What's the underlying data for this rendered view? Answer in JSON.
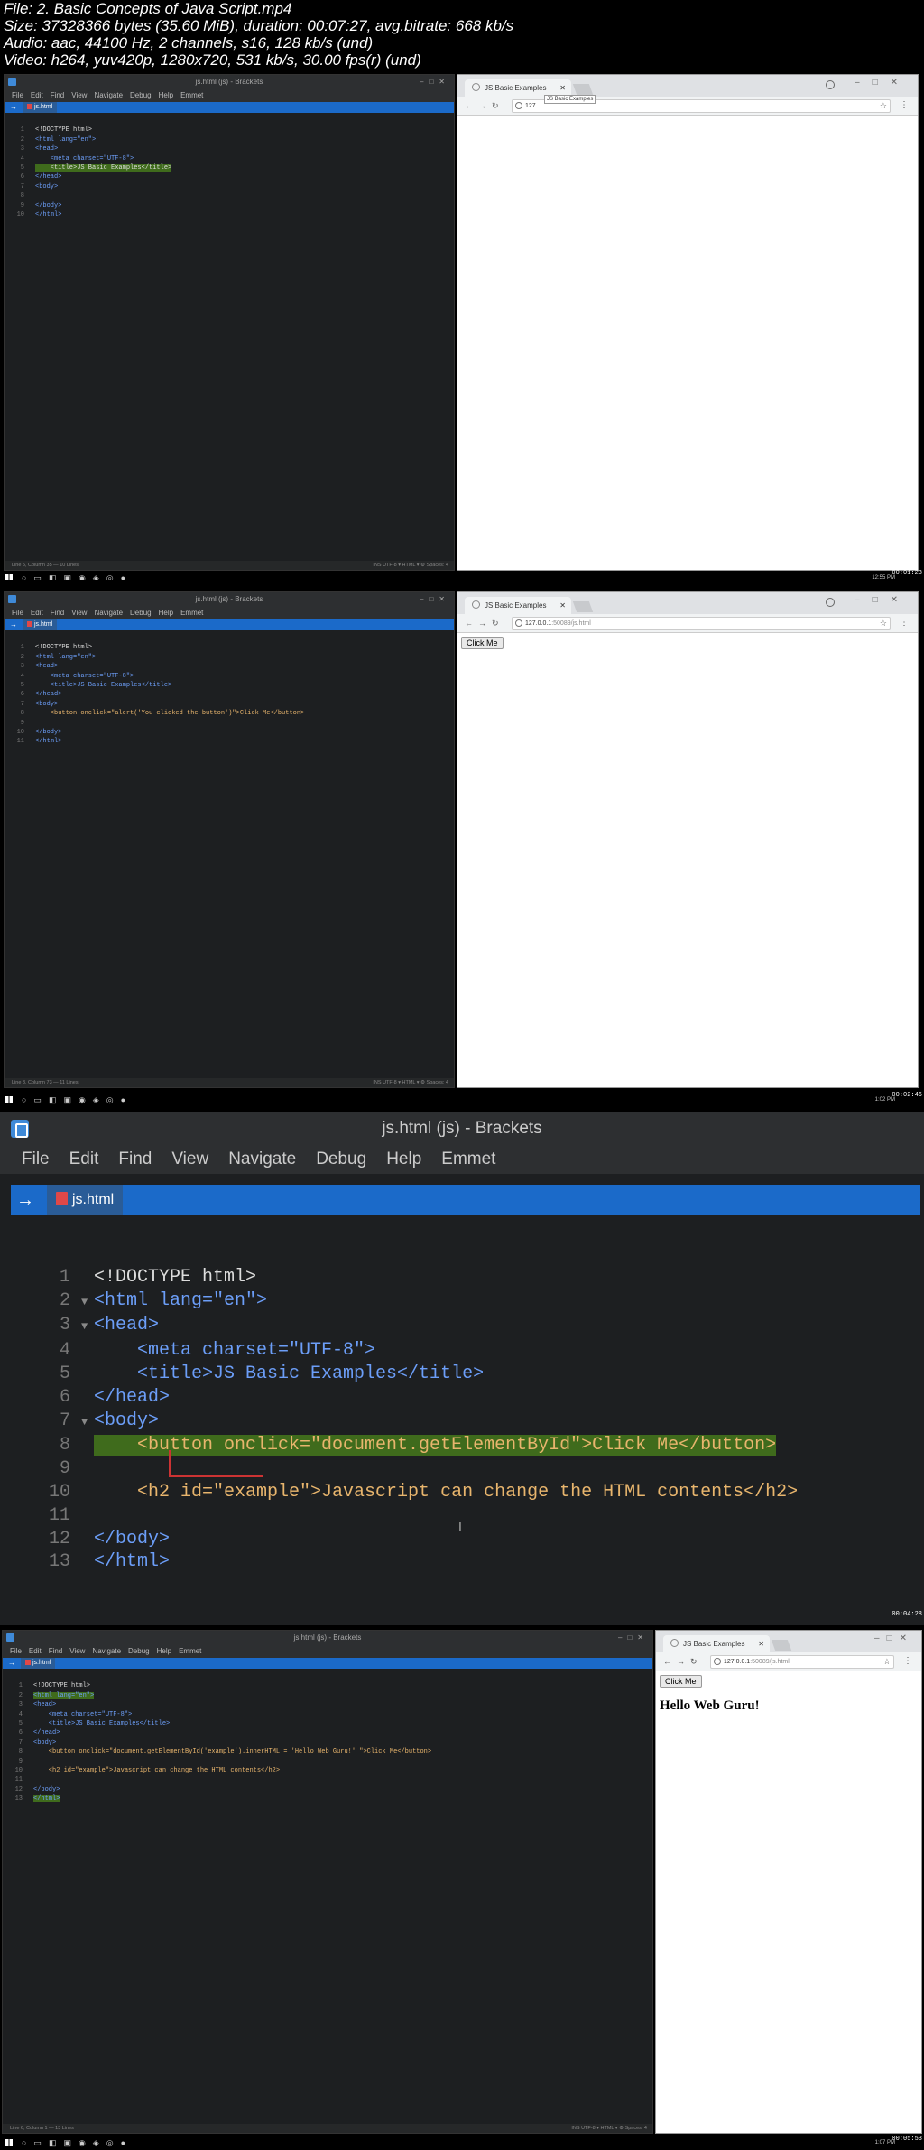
{
  "file_info": [
    "File: 2. Basic Concepts of Java Script.mp4",
    "Size: 37328366 bytes (35.60 MiB), duration: 00:07:27, avg.bitrate: 668 kb/s",
    "Audio: aac, 44100 Hz, 2 channels, s16, 128 kb/s (und)",
    "Video: h264, yuv420p, 1280x720, 531 kb/s, 30.00 fps(r) (und)"
  ],
  "editor": {
    "window_title": "js.html (js) - Brackets",
    "menu": [
      "File",
      "Edit",
      "Find",
      "View",
      "Navigate",
      "Debug",
      "Help",
      "Emmet"
    ],
    "tab_label": "js.html"
  },
  "browser": {
    "tab_title": "JS Basic Examples",
    "url_host": "127.0.0.1",
    "url_rest": ":50089/js.html",
    "tooltip": "JS Basic Examples"
  },
  "frame1": {
    "code": [
      "<!DOCTYPE html>",
      "<html lang=\"en\">",
      "<head>",
      "    <meta charset=\"UTF-8\">",
      "    <title>JS Basic Examples</title>",
      "</head>",
      "<body>",
      "",
      "</body>",
      "</html>"
    ],
    "status_left": "Line 5, Column 35 — 10 Lines",
    "status_right": "INS    UTF-8 ▾    HTML ▾    ⚙    Spaces: 4",
    "url_partial": "127.",
    "clock": "12:55 PM",
    "timestamp": "00:01:23"
  },
  "frame2": {
    "code": [
      "<!DOCTYPE html>",
      "<html lang=\"en\">",
      "<head>",
      "    <meta charset=\"UTF-8\">",
      "    <title>JS Basic Examples</title>",
      "</head>",
      "<body>",
      "    <button onclick=\"alert('You clicked the button')\">Click Me</button>",
      "",
      "</body>",
      "</html>"
    ],
    "status_left": "Line 8, Column 73 — 11 Lines",
    "status_right": "INS    UTF-8 ▾    HTML ▾    ⚙    Spaces: 4",
    "button_label": "Click Me",
    "clock": "1:02 PM",
    "timestamp": "00:02:46"
  },
  "frame3": {
    "code": [
      "<!DOCTYPE html>",
      "<html lang=\"en\">",
      "<head>",
      "    <meta charset=\"UTF-8\">",
      "    <title>JS Basic Examples</title>",
      "</head>",
      "<body>",
      "    <button onclick=\"document.getElementById\">Click Me</button>",
      "",
      "    <h2 id=\"example\">Javascript can change the HTML contents</h2>",
      "",
      "</body>",
      "</html>"
    ],
    "timestamp": "00:04:28"
  },
  "frame4": {
    "code": [
      "<!DOCTYPE html>",
      "<html lang=\"en\">",
      "<head>",
      "    <meta charset=\"UTF-8\">",
      "    <title>JS Basic Examples</title>",
      "</head>",
      "<body>",
      "    <button onclick=\"document.getElementById('example').innerHTML = 'Hello Web Guru!' \">Click Me</button>",
      "",
      "    <h2 id=\"example\">Javascript can change the HTML contents</h2>",
      "",
      "</body>",
      "</html>"
    ],
    "status_left": "Line 6, Column 1 — 13 Lines",
    "status_right": "INS    UTF-8 ▾    HTML ▾    ⚙    Spaces: 4",
    "button_label": "Click Me",
    "heading": "Hello Web Guru!",
    "clock": "1:07 PM",
    "timestamp": "00:05:53"
  },
  "colors": {
    "editor_bg": "#1d1f21",
    "tab_bar": "#1b6ac9",
    "tag": "#6c9ef8",
    "attribute": "#d89333",
    "value": "#e8b56d",
    "highlight": "#3f6b1c"
  }
}
